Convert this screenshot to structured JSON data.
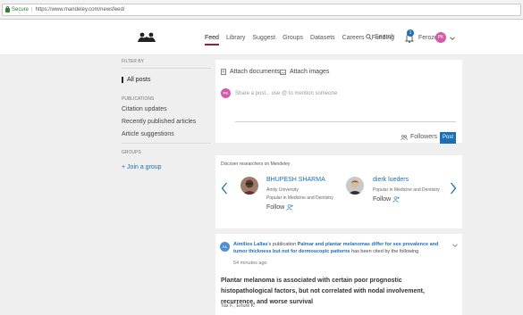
{
  "browser": {
    "secure_label": "Secure",
    "url": "https://www.mandeley.com/newsfeed/"
  },
  "nav": {
    "links": [
      "Feed",
      "Library",
      "Suggest",
      "Groups",
      "Datasets",
      "Careers",
      "Funding"
    ],
    "active": "Feed",
    "search_label": "Search",
    "notification_count": "1",
    "user_name": "Feroze",
    "avatar_initials": "PK"
  },
  "sidebar": {
    "filter_by": "FILTER BY",
    "all_posts": "All posts",
    "publications_title": "PUBLICATIONS",
    "publications": [
      "Citation updates",
      "Recently published articles",
      "Article suggestions"
    ],
    "groups_title": "GROUPS",
    "join_group": "Join a group"
  },
  "composer": {
    "attach_documents": "Attach documents",
    "attach_images": "Attach images",
    "avatar_initials": "PK",
    "placeholder": "Share a post... use @ to mention someone",
    "followers_label": "Followers",
    "post_label": "Post"
  },
  "discover": {
    "title": "Discover researchers on Mendeley",
    "people": [
      {
        "name": "BHUPESH SHARMA",
        "affiliation": "Amity University",
        "popular": "Popular in Medicine and Dentistry",
        "follow": "Follow"
      },
      {
        "name": "dierk lueders",
        "popular": "Popular in Medicine and Dentistry",
        "follow": "Follow"
      }
    ]
  },
  "feed_item": {
    "avatar_initials": "AL",
    "author": "Aimilios Lallas",
    "possessive": "'s publication ",
    "publication_title": "Palmar and plantar melanomas differ for sex prevalence and tumor thickness but not for dermoscopic patterns",
    "suffix": " has been cited by the following",
    "time": "54 minutes ago",
    "article_title": "Plantar melanoma is associated with certain poor prognostic histopathological factors, but not correlated with nodal involvement, recurrence, and worse survival",
    "authors": "Tas F., Erturk K."
  },
  "colors": {
    "brand_red": "#9e1b32",
    "link_blue": "#1a6fb5",
    "avatar_pink": "#d35aa6",
    "background_gray": "#efefef"
  }
}
